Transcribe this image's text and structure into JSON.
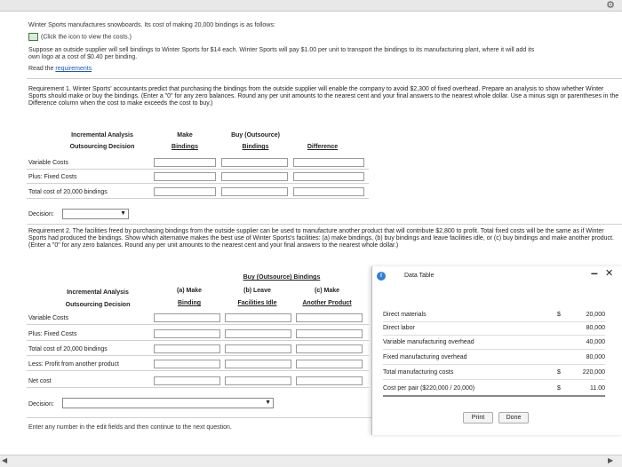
{
  "intro": {
    "line1": "Winter Sports manufactures snowboards. Its cost of making 20,000 bindings is as follows:",
    "costs_link": "(Click the icon to view the costs.)",
    "line3": "Suppose an outside supplier will sell bindings to Winter Sports for $14 each. Winter Sports will pay $1.00 per unit to transport the bindings to its manufacturing plant, where it will add its",
    "line4": "own logo at a cost of $0.40 per binding.",
    "read_the": "Read the",
    "requirements_link": "requirements"
  },
  "req1": {
    "text": "Requirement 1. Winter Sports' accountants predict that purchasing the bindings from the outside supplier will enable the company to avoid $2,300 of fixed overhead. Prepare an analysis to show whether Winter Sports should make or buy the bindings. (Enter a \"0\" for any zero balances. Round any per unit amounts to the nearest cent and your final answers to the nearest whole dollar. Use a minus sign or parentheses in the Difference column when the cost to make exceeds the cost to buy.)",
    "header_a": "Incremental Analysis",
    "header_b": "Outsourcing Decision",
    "col_make_1": "Make",
    "col_make_2": "Bindings",
    "col_buy_1": "Buy (Outsource)",
    "col_buy_2": "Bindings",
    "col_diff": "Difference",
    "rows": [
      "Variable Costs",
      "Plus: Fixed Costs",
      "Total cost of 20,000 bindings"
    ],
    "decision_label": "Decision:"
  },
  "req2": {
    "text": "Requirement 2. The facilities freed by purchasing bindings from the outside supplier can be used to manufacture another product that will contribute $2,800 to profit. Total fixed costs will be the same as if Winter Sports had produced the bindings. Show which alternative makes the best use of Winter Sports's facilities: (a) make bindings, (b) buy bindings and leave facilities idle, or (c) buy bindings and make another product. (Enter a \"0\" for any zero balances. Round any per unit amounts to the nearest cent and your final answers to the nearest whole dollar.)",
    "header_a": "Incremental Analysis",
    "header_b": "Outsourcing Decision",
    "group_header": "Buy (Outsource) Bindings",
    "col_a_1": "(a) Make",
    "col_a_2": "Binding",
    "col_b_1": "(b) Leave",
    "col_b_2": "Facilities Idle",
    "col_c_1": "(c) Make",
    "col_c_2": "Another Product",
    "rows": [
      "Variable Costs",
      "Plus: Fixed Costs",
      "Total cost of 20,000 bindings",
      "Less: Profit from another product",
      "Net cost"
    ],
    "decision_label": "Decision:"
  },
  "footer": {
    "prompt": "Enter any number in the edit fields and then continue to the next question."
  },
  "data_table": {
    "title": "Data Table",
    "rows": [
      {
        "label": "Direct materials",
        "sym": "$",
        "value": "20,000"
      },
      {
        "label": "Direct labor",
        "sym": "",
        "value": "80,000"
      },
      {
        "label": "Variable manufacturing overhead",
        "sym": "",
        "value": "40,000"
      },
      {
        "label": "Fixed manufacturing overhead",
        "sym": "",
        "value": "80,000"
      },
      {
        "label": "Total manufacturing costs",
        "sym": "$",
        "value": "220,000"
      },
      {
        "label": "Cost per pair ($220,000 / 20,000)",
        "sym": "$",
        "value": "11.00"
      }
    ],
    "print_label": "Print",
    "done_label": "Done",
    "minimize_glyph": "–",
    "close_glyph": "✕"
  },
  "icons": {
    "gear": "gear-icon",
    "table": "table-icon",
    "info": "info-icon"
  },
  "colors": {
    "link": "#1a5bb5",
    "info_badge": "#2f7fd8"
  }
}
